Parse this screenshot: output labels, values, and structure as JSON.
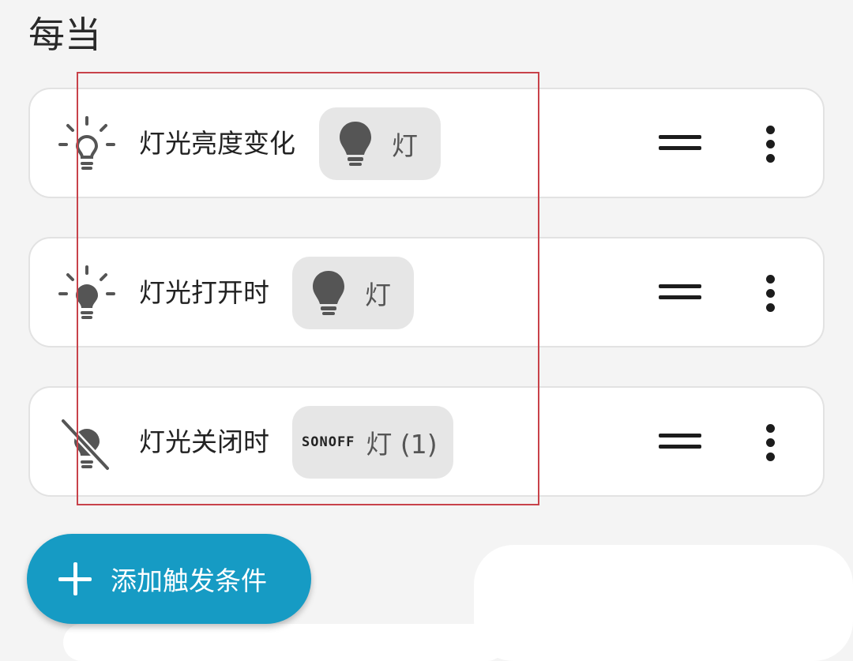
{
  "section": {
    "title": "每当"
  },
  "triggers": [
    {
      "label": "灯光亮度变化",
      "chip": {
        "icon": "lightbulb-icon",
        "text": "灯"
      },
      "icon": "lightbulb-rays-outline-icon"
    },
    {
      "label": "灯光打开时",
      "chip": {
        "icon": "lightbulb-icon",
        "text": "灯"
      },
      "icon": "lightbulb-on-icon"
    },
    {
      "label": "灯光关闭时",
      "chip": {
        "icon": "sonoff-logo",
        "brand": "SONOFF",
        "text": "灯 (1)"
      },
      "icon": "lightbulb-off-icon"
    }
  ],
  "add_button": {
    "label": "添加触发条件"
  },
  "colors": {
    "accent": "#169bc4",
    "highlight": "#c8424a",
    "chip_bg": "#e6e6e6"
  }
}
